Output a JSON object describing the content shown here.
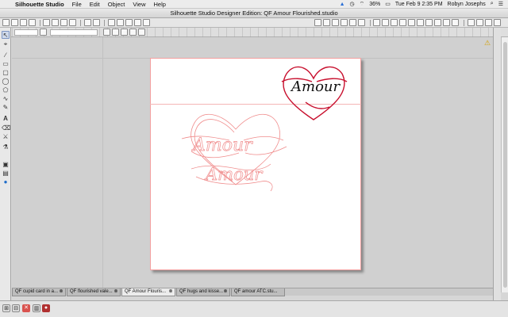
{
  "menubar": {
    "apple": "",
    "app_name": "Silhouette Studio",
    "items": [
      "File",
      "Edit",
      "Object",
      "View",
      "Help"
    ],
    "battery": "36%",
    "clock": "Tue Feb 9  2:35 PM",
    "user": "Robyn Josephs"
  },
  "window": {
    "title": "Silhouette Studio Designer Edition: QF Amour Flourished.studio"
  },
  "canvas": {
    "text_outline_1": "Amour",
    "text_outline_2": "Amour",
    "text_filled": "Amour",
    "colors": {
      "outline": "#f08c8c",
      "heart_red": "#c8102e",
      "text_dark": "#111111"
    }
  },
  "tabs": [
    {
      "label": "QF cupid card in a..."
    },
    {
      "label": "QF flourished vale..."
    },
    {
      "label": "QF Amour Flouris...",
      "active": true
    },
    {
      "label": "QF hugs and kisse..."
    },
    {
      "label": "QF amour ATC.stu..."
    }
  ],
  "icons": {
    "warning": "⚠",
    "close": "⊗"
  }
}
